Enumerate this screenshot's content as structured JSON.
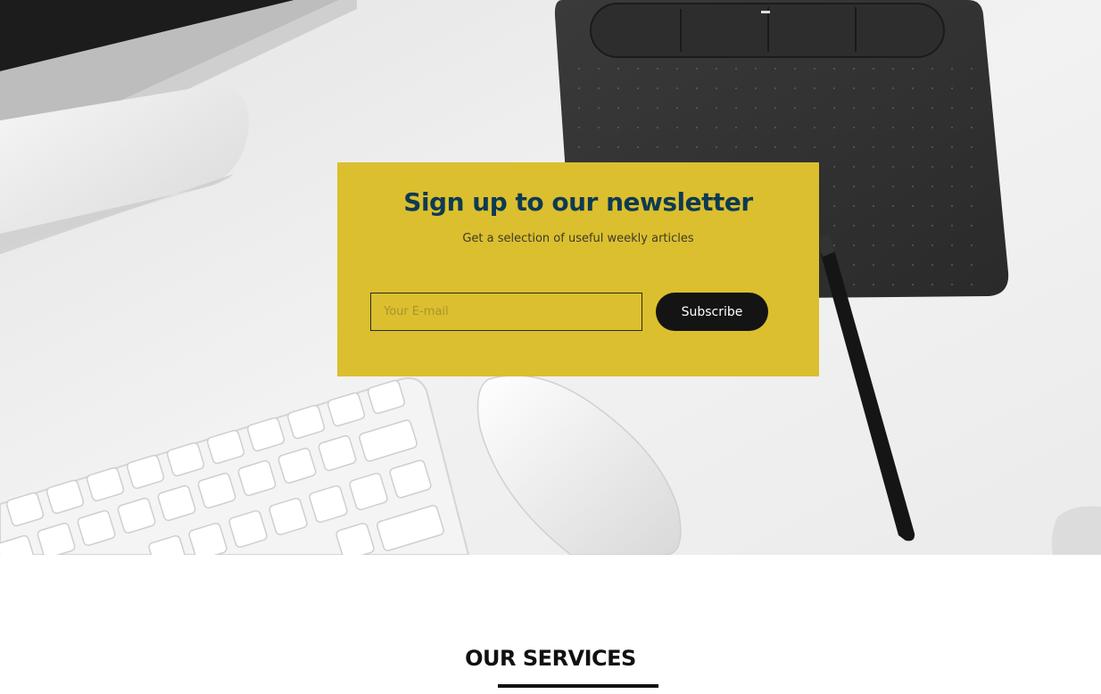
{
  "newsletter": {
    "title": "Sign up to our newsletter",
    "subtitle": "Get a selection of useful weekly articles",
    "email_placeholder": "Your E-mail",
    "email_value": "",
    "subscribe_label": "Subscribe",
    "background_color": "#dbbf2e",
    "title_color": "#0e3a52",
    "button_color": "#141414"
  },
  "hero": {
    "image_description_icons": [
      "monitor-stand-icon",
      "keyboard-icon",
      "mouse-icon",
      "drawing-tablet-icon",
      "stylus-pen-icon"
    ]
  },
  "services": {
    "title": "OUR SERVICES"
  }
}
